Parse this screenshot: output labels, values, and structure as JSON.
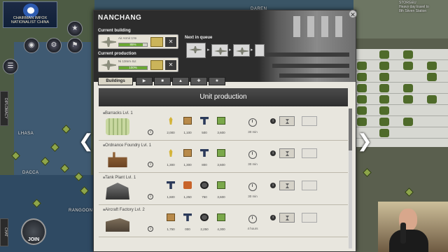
{
  "country": {
    "title_line1": "CHAIRMAN IMFOX",
    "title_line2": "NATIONALIST CHINA"
  },
  "map_labels": {
    "dacca": "DACCA",
    "lhasa": "LHASA",
    "rangoon": "RANGOON",
    "daren": "DAREN",
    "top_right_line1": "STORGEU",
    "top_right_line2": "Heavy day travel to",
    "top_right_line3": "8th Stiven Station"
  },
  "left_hud": {
    "join_label": "JOIN",
    "side_tab_top": "DIPLOMACY",
    "side_tab_bottom": "CHAT"
  },
  "dialog": {
    "city": "NANCHANG",
    "current_building_label": "Current building",
    "current_production_label": "Current production",
    "next_in_queue_label": "Next in queue",
    "current_building": {
      "name": "Air Armir 1Ye",
      "percent_label": "85%",
      "progress": 0.85
    },
    "current_production": {
      "name": "Ni 13mm 4Lt",
      "percent_label": "100%",
      "progress": 1.0
    },
    "tabs": [
      {
        "label": "Buildings",
        "active": true
      },
      {
        "label": "",
        "icon": "pistol-icon"
      },
      {
        "label": "",
        "icon": "tank-icon"
      },
      {
        "label": "",
        "icon": "ship-icon"
      },
      {
        "label": "",
        "icon": "plane-icon"
      },
      {
        "label": "",
        "icon": "star-icon"
      }
    ],
    "unit_production_title": "Unit production",
    "buildings": [
      {
        "name": "Barracks Lvl. 1",
        "image": "barracks",
        "resources": [
          {
            "icon": "corn",
            "value": "2,000"
          },
          {
            "icon": "box",
            "value": "1,100"
          },
          {
            "icon": "steel",
            "value": "500"
          },
          {
            "icon": "cash",
            "value": "3,600"
          }
        ],
        "time": "30 min"
      },
      {
        "name": "Ordnance Foundry Lvl. 1",
        "image": "ordnance",
        "resources": [
          {
            "icon": "corn",
            "value": "1,300"
          },
          {
            "icon": "box",
            "value": "1,300"
          },
          {
            "icon": "steel",
            "value": "800"
          },
          {
            "icon": "cash",
            "value": "3,600"
          }
        ],
        "time": "30 min"
      },
      {
        "name": "Tank Plant Lvl. 1",
        "image": "tank",
        "resources": [
          {
            "icon": "steel",
            "value": "1,600"
          },
          {
            "icon": "oil",
            "value": "1,250"
          },
          {
            "icon": "rubber",
            "value": "750"
          },
          {
            "icon": "cash",
            "value": "3,600"
          }
        ],
        "time": "30 min"
      },
      {
        "name": "Aircraft Factory Lvl. 2",
        "image": "aircraft",
        "resources": [
          {
            "icon": "box",
            "value": "1,750"
          },
          {
            "icon": "steel",
            "value": "000"
          },
          {
            "icon": "rubber",
            "value": "2,250"
          },
          {
            "icon": "cash",
            "value": "4,300"
          }
        ],
        "time": "4 hours"
      }
    ]
  }
}
